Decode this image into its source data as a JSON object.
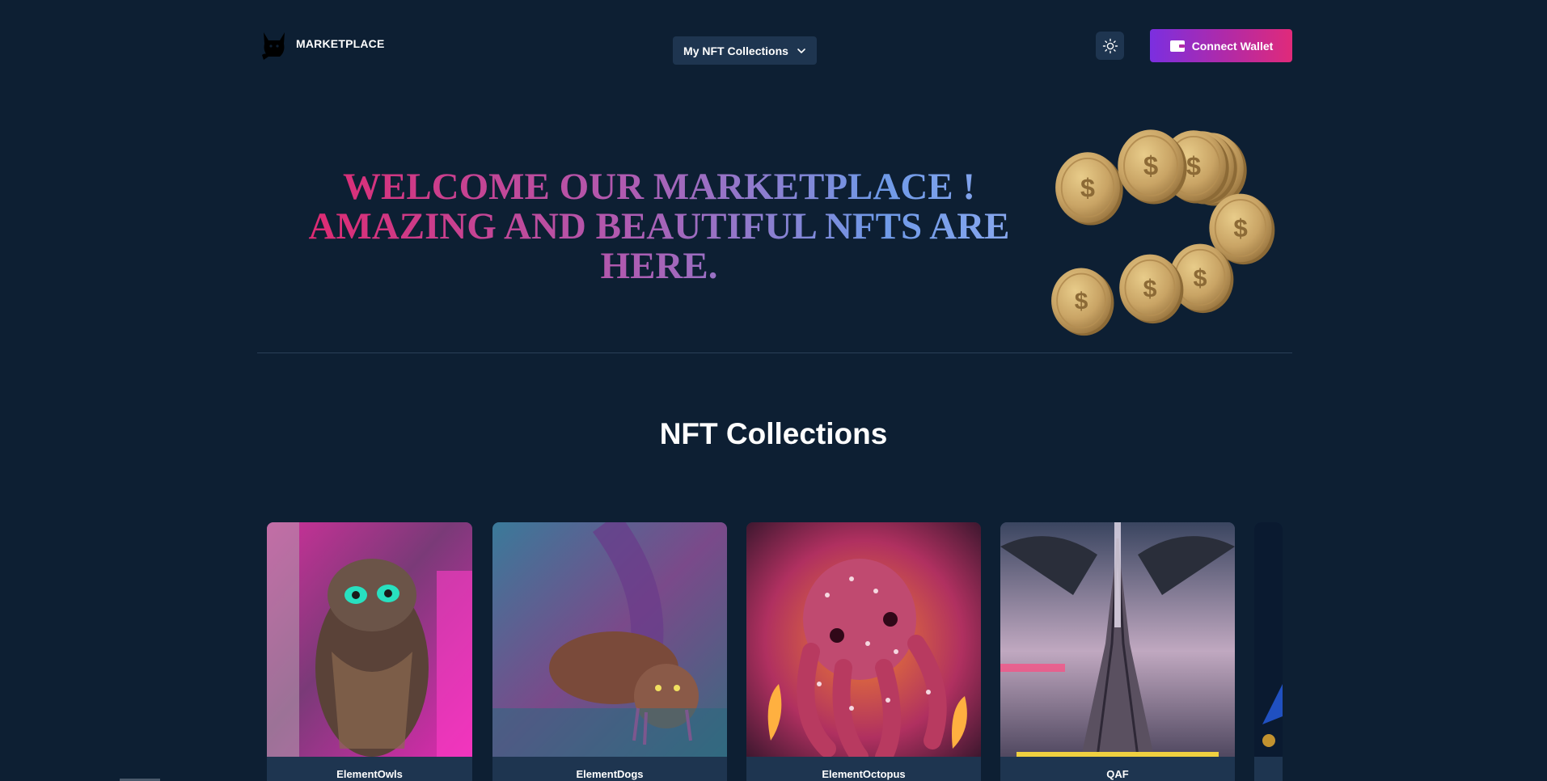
{
  "header": {
    "logo_text": "MARKETPLACE",
    "collections_dropdown": "My NFT Collections",
    "connect_wallet": "Connect Wallet"
  },
  "hero": {
    "line1": "WELCOME OUR MARKETPLACE !",
    "line2": "AMAZING AND BEAUTIFUL NFTS ARE",
    "line3": "HERE."
  },
  "collections": {
    "title": "NFT Collections",
    "items": [
      {
        "name": "ElementOwls"
      },
      {
        "name": "ElementDogs"
      },
      {
        "name": "ElementOctopus"
      },
      {
        "name": "QAF"
      },
      {
        "name": ""
      }
    ]
  },
  "colors": {
    "background": "#0d1f33",
    "surface": "#1e3550",
    "accent_start": "#7b2fe0",
    "accent_end": "#e02a7a",
    "title_pink": "#e0286f",
    "title_blue": "#6f9ae8"
  },
  "icons": [
    "cat-logo-icon",
    "chevron-down-icon",
    "sun-icon",
    "wallet-icon",
    "dollar-coin-icon"
  ]
}
